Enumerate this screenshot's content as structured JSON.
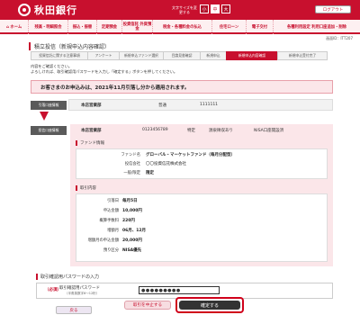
{
  "header": {
    "bank_name": "秋田銀行",
    "font_size_label": "文字サイズを変更する",
    "font_sizes": [
      "小",
      "中",
      "大"
    ],
    "logout_label": "ログアウト"
  },
  "nav": {
    "items": [
      "ホーム",
      "残高・明細照会",
      "振込・振替",
      "定期預金",
      "投資信託 外貨預金",
      "税金・各種料金の払込",
      "住宅ローン",
      "電子交付",
      "各種利用設定 利用口座追加・削除"
    ]
  },
  "timestamp": "画面ID：ITT207",
  "page_title": "積立投信（新規申込内容確認）",
  "steps": [
    "投資信託に関する注意事項",
    "アンケート",
    "新規申込ファンド選択",
    "目論見書確認",
    "新規申込",
    "新規申込内容確認",
    "新規申込受付完了"
  ],
  "current_step": 5,
  "instructions": [
    "内容をご確認ください。",
    "よろしければ、取引確認用パスワードを入力し「確定する」ボタンを押してください。"
  ],
  "notice": "お客さまのお申込みは、2021年11月引落し分から適用されます。",
  "withdraw": {
    "label": "引落口座情報",
    "branch": "本店営業部",
    "type": "普通",
    "number": "1111111"
  },
  "invest": {
    "label": "投信口座情報",
    "branch": "本店営業部",
    "account": "0123456789",
    "kind": "特定",
    "tax": "源泉徴収あり",
    "nisa": "NISA口座開設済"
  },
  "fund": {
    "heading": "ファンド情報",
    "rows": [
      {
        "key": "ファンド名",
        "value": "グローバル・マーケットファンド（毎月分配型）"
      },
      {
        "key": "投信会社",
        "value": "〇〇投資信託株式会社"
      },
      {
        "key": "一般/限定",
        "value": "限定"
      }
    ]
  },
  "trade": {
    "heading": "取引内容",
    "rows": [
      {
        "key": "引落日",
        "value": "毎月5日"
      },
      {
        "key": "申込金額",
        "value": "10,000円"
      },
      {
        "key": "概算手数料",
        "value": "220円"
      },
      {
        "key": "増額月",
        "value": "06月、12月"
      },
      {
        "key": "増額月の申込金額",
        "value": "20,000円"
      },
      {
        "key": "預り区分",
        "value": "NISA優先"
      }
    ]
  },
  "password": {
    "title": "取引確認用パスワードの入力",
    "required": "（必須）",
    "label": "取引確認用パスワード",
    "sub": "（半角英数字6〜12桁）",
    "value": "●●●●●●●●●"
  },
  "buttons": {
    "cancel": "取引を中止する",
    "confirm": "確定する",
    "back": "戻る"
  }
}
